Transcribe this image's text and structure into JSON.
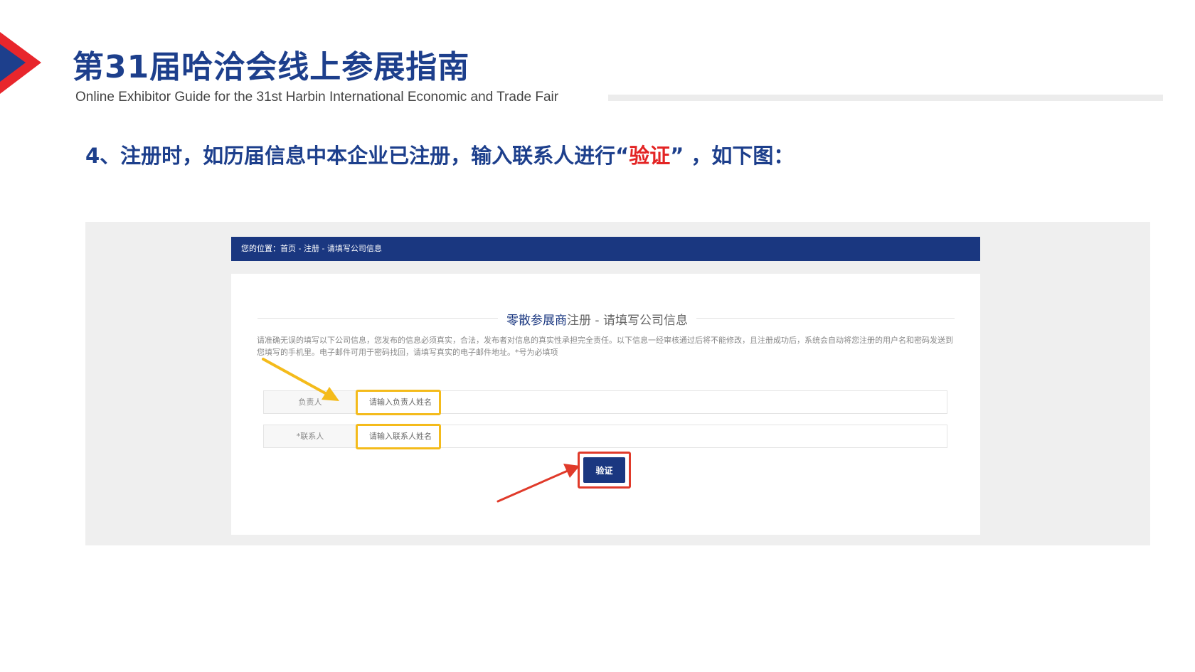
{
  "slide": {
    "title": "第31届哈洽会线上参展指南",
    "subtitle": "Online Exhibitor Guide for the 31st Harbin International Economic and Trade Fair",
    "step_prefix": "4、注册时，如历届信息中本企业已注册，输入联系人进行“",
    "step_highlight": "验证",
    "step_suffix": "” ，如下图："
  },
  "breadcrumb": {
    "text": "您的位置：首页 - 注册 - 请填写公司信息"
  },
  "form": {
    "title_strong": "零散参展商",
    "title_rest": "注册 - 请填写公司信息",
    "notice": "请准确无误的填写以下公司信息，您发布的信息必须真实，合法，发布者对信息的真实性承担完全责任。以下信息一经审核通过后将不能修改，且注册成功后，系统会自动将您注册的用户名和密码发送到您填写的手机里。电子邮件可用于密码找回，请填写真实的电子邮件地址。*号为必填项",
    "fields": [
      {
        "label": "负责人",
        "placeholder": "请输入负责人姓名",
        "value": ""
      },
      {
        "label": "*联系人",
        "placeholder": "请输入联系人姓名",
        "value": ""
      }
    ],
    "verify_label": "验证"
  },
  "colors": {
    "brand_blue": "#1d3f8c",
    "nav_blue": "#1a3780",
    "highlight_red": "#e32424",
    "annotation_yellow": "#f4bb1b",
    "annotation_red": "#e03a2a"
  },
  "icons": {
    "logo": "red-blue-arrow-logo",
    "annotation_arrow_1": "yellow-arrow-icon",
    "annotation_arrow_2": "red-arrow-icon"
  }
}
